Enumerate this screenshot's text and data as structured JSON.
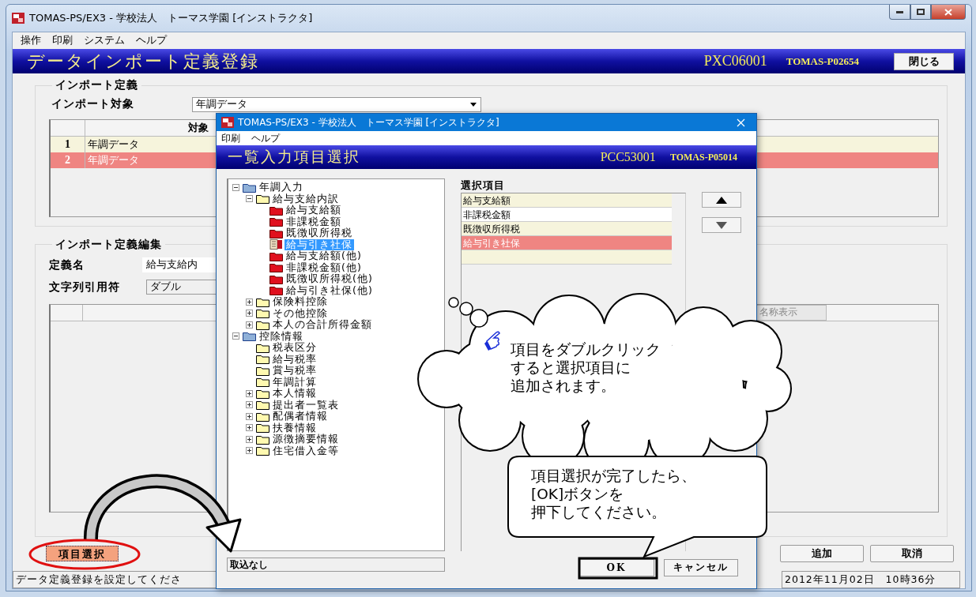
{
  "window": {
    "title": "TOMAS-PS/EX3 - 学校法人　トーマス学園 [インストラクタ]"
  },
  "menu": [
    "操作",
    "印刷",
    "システム",
    "ヘルプ"
  ],
  "header": {
    "title": "データインポート定義登録",
    "program_id": "PXC06001",
    "user_id": "TOMAS-P02654",
    "close_button": "閉じる"
  },
  "import_definition": {
    "label": "インポート定義",
    "target_label": "インポート対象",
    "target_value": "年調データ",
    "columns": [
      "対象"
    ],
    "rows": [
      {
        "number": "1",
        "target": "年調データ",
        "selected": false
      },
      {
        "number": "2",
        "target": "年調データ",
        "selected": true
      }
    ]
  },
  "import_edit": {
    "label": "インポート定義編集",
    "name_label": "定義名",
    "name_value": "給与支給内",
    "quote_label": "文字列引用符",
    "quote_value": "ダブル",
    "name_display_header": "名称表示"
  },
  "item_select_button": "項目選択",
  "buttons": [
    "追加",
    "取消"
  ],
  "status_bar": {
    "message": "データ定義登録を設定してくださ",
    "datetime": "2012年11月02日　10時36分"
  },
  "dialog": {
    "title": "TOMAS-PS/EX3 - 学校法人　トーマス学園 [インストラクタ]",
    "menu": [
      "印刷",
      "ヘルプ"
    ],
    "header": {
      "title": "一覧入力項目選択",
      "program_id": "PCC53001",
      "user_id": "TOMAS-P05014"
    },
    "tree": [
      {
        "label": "年調入力",
        "kind": "root",
        "expanded": true,
        "selected": false,
        "children": [
          {
            "label": "給与支給内訳",
            "kind": "folder",
            "expanded": true,
            "selected": false,
            "children": [
              {
                "label": "給与支給額",
                "kind": "leaf",
                "selected": false
              },
              {
                "label": "非課税金額",
                "kind": "leaf",
                "selected": false
              },
              {
                "label": "既徴収所得税",
                "kind": "leaf",
                "selected": false
              },
              {
                "label": "給与引き社保",
                "kind": "item",
                "selected": true
              },
              {
                "label": "給与支給額(他)",
                "kind": "leaf",
                "selected": false
              },
              {
                "label": "非課税金額(他)",
                "kind": "leaf",
                "selected": false
              },
              {
                "label": "既徴収所得税(他)",
                "kind": "leaf",
                "selected": false
              },
              {
                "label": "給与引き社保(他)",
                "kind": "leaf",
                "selected": false
              }
            ]
          },
          {
            "label": "保険料控除",
            "kind": "folder",
            "expanded": false,
            "selected": false
          },
          {
            "label": "その他控除",
            "kind": "folder",
            "expanded": false,
            "selected": false
          },
          {
            "label": "本人の合計所得金額",
            "kind": "folder",
            "expanded": false,
            "selected": false
          }
        ]
      },
      {
        "label": "控除情報",
        "kind": "root",
        "expanded": true,
        "selected": false,
        "children": [
          {
            "label": "税表区分",
            "kind": "folder",
            "selected": false
          },
          {
            "label": "給与税率",
            "kind": "folder",
            "selected": false
          },
          {
            "label": "賞与税率",
            "kind": "folder",
            "selected": false
          },
          {
            "label": "年調計算",
            "kind": "folder",
            "selected": false
          },
          {
            "label": "本人情報",
            "kind": "folder",
            "expanded": false,
            "selected": false
          },
          {
            "label": "提出者一覧表",
            "kind": "folder",
            "expanded": false,
            "selected": false
          },
          {
            "label": "配偶者情報",
            "kind": "folder",
            "expanded": false,
            "selected": false
          },
          {
            "label": "扶養情報",
            "kind": "folder",
            "expanded": false,
            "selected": false
          },
          {
            "label": "源徴摘要情報",
            "kind": "folder",
            "expanded": false,
            "selected": false
          },
          {
            "label": "住宅借入金等",
            "kind": "folder",
            "expanded": false,
            "selected": false
          }
        ]
      }
    ],
    "selected_items": {
      "label": "選択項目",
      "rows": [
        {
          "text": "給与支給額",
          "selected": false
        },
        {
          "text": "非課税金額",
          "selected": false
        },
        {
          "text": "既徴収所得税",
          "selected": false
        },
        {
          "text": "給与引き社保",
          "selected": true
        }
      ]
    },
    "import_status": "取込なし",
    "buttons": [
      "OK",
      "キャンセル"
    ]
  },
  "annotations": {
    "cloud_lines": [
      "項目をダブルクリック",
      "すると選択項目に",
      "追加されます。"
    ],
    "callout_lines": [
      "項目選択が完了したら、",
      "[OK]ボタンを",
      "押下してください。"
    ]
  }
}
